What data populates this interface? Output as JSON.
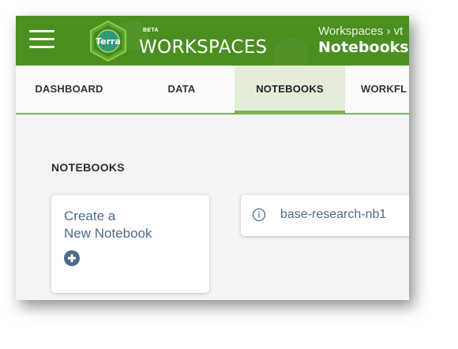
{
  "header": {
    "beta_label": "BETA",
    "app_title": "WORKSPACES",
    "breadcrumb": "Workspaces › vt",
    "workspace_name": "Notebooks",
    "logo_text": "Terra",
    "accent_color": "#4a8f1f"
  },
  "tabs": [
    {
      "label": "DASHBOARD",
      "active": false
    },
    {
      "label": "DATA",
      "active": false
    },
    {
      "label": "NOTEBOOKS",
      "active": true
    },
    {
      "label": "WORKFL",
      "active": false
    }
  ],
  "main": {
    "section_title": "NOTEBOOKS",
    "create_card": {
      "line1": "Create a",
      "line2": "New Notebook",
      "icon": "plus-circle-icon"
    },
    "notebooks": [
      {
        "name": "base-research-nb1",
        "icon": "info-icon"
      }
    ]
  }
}
